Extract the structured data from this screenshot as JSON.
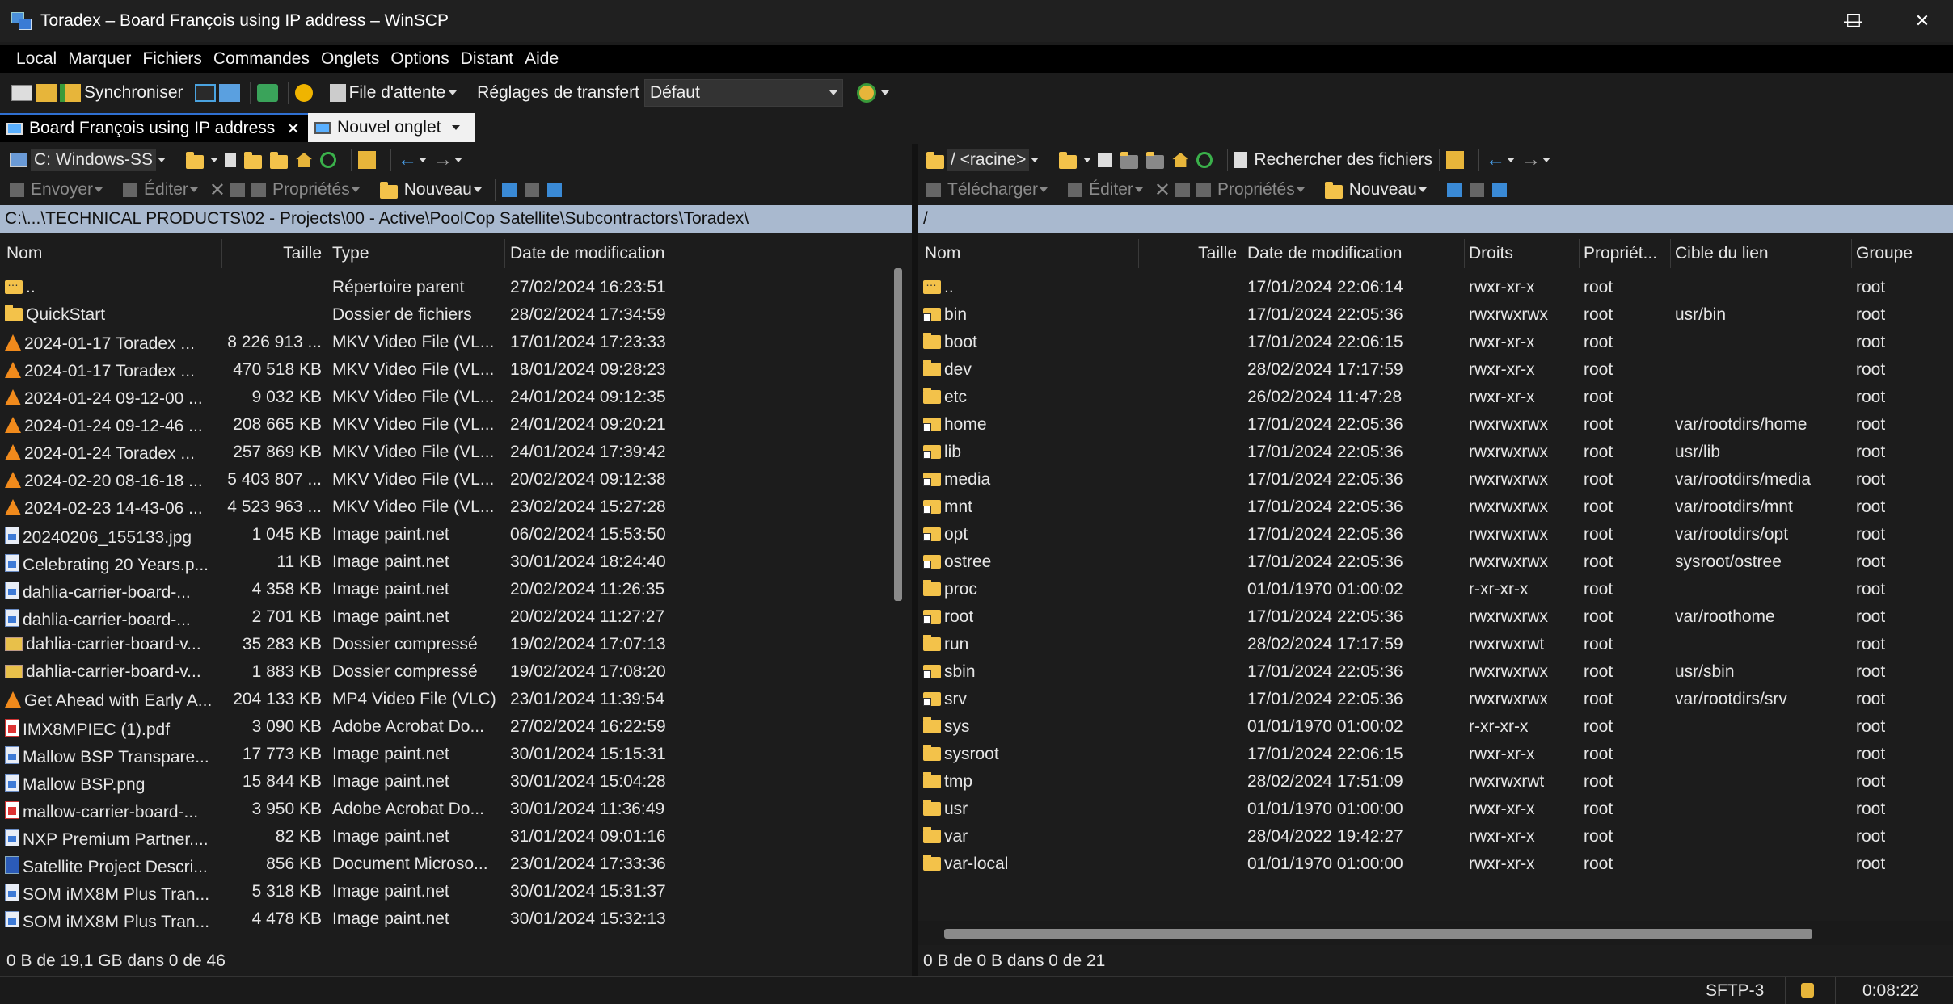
{
  "window": {
    "title": "Toradex – Board François using IP address – WinSCP",
    "min_glyph": "—",
    "max_glyph": "☐",
    "close_glyph": "✕"
  },
  "menu": [
    "Local",
    "Marquer",
    "Fichiers",
    "Commandes",
    "Onglets",
    "Options",
    "Distant",
    "Aide"
  ],
  "toolbar": {
    "sync_label": "Synchroniser",
    "queue_label": "File d'attente",
    "transfer_settings_label": "Réglages de transfert",
    "transfer_preset": "Défaut"
  },
  "tabs": [
    {
      "label": "Board François using IP address",
      "close": "✕"
    },
    {
      "label": "Nouvel onglet"
    }
  ],
  "left": {
    "drive": "C: Windows-SS",
    "actions": {
      "send": "Envoyer",
      "edit": "Éditer",
      "props": "Propriétés",
      "new": "Nouveau"
    },
    "path": "C:\\...\\TECHNICAL PRODUCTS\\02 - Projects\\00 - Active\\PoolCop Satellite\\Subcontractors\\Toradex\\",
    "columns": {
      "name": "Nom",
      "size": "Taille",
      "type": "Type",
      "date": "Date de modification"
    },
    "rows": [
      {
        "icon": "up",
        "name": "..",
        "size": "",
        "type": "Répertoire parent",
        "date": "27/02/2024 16:23:51"
      },
      {
        "icon": "folder",
        "name": "QuickStart",
        "size": "",
        "type": "Dossier de fichiers",
        "date": "28/02/2024 17:34:59"
      },
      {
        "icon": "vlc",
        "name": "2024-01-17 Toradex ...",
        "size": "8 226 913 ...",
        "type": "MKV Video File (VL...",
        "date": "17/01/2024 17:23:33"
      },
      {
        "icon": "vlc",
        "name": "2024-01-17 Toradex ...",
        "size": "470 518 KB",
        "type": "MKV Video File (VL...",
        "date": "18/01/2024 09:28:23"
      },
      {
        "icon": "vlc",
        "name": "2024-01-24 09-12-00 ...",
        "size": "9 032 KB",
        "type": "MKV Video File (VL...",
        "date": "24/01/2024 09:12:35"
      },
      {
        "icon": "vlc",
        "name": "2024-01-24 09-12-46 ...",
        "size": "208 665 KB",
        "type": "MKV Video File (VL...",
        "date": "24/01/2024 09:20:21"
      },
      {
        "icon": "vlc",
        "name": "2024-01-24 Toradex ...",
        "size": "257 869 KB",
        "type": "MKV Video File (VL...",
        "date": "24/01/2024 17:39:42"
      },
      {
        "icon": "vlc",
        "name": "2024-02-20 08-16-18 ...",
        "size": "5 403 807 ...",
        "type": "MKV Video File (VL...",
        "date": "20/02/2024 09:12:38"
      },
      {
        "icon": "vlc",
        "name": "2024-02-23 14-43-06 ...",
        "size": "4 523 963 ...",
        "type": "MKV Video File (VL...",
        "date": "23/02/2024 15:27:28"
      },
      {
        "icon": "img",
        "name": "20240206_155133.jpg",
        "size": "1 045 KB",
        "type": "Image paint.net",
        "date": "06/02/2024 15:53:50"
      },
      {
        "icon": "img",
        "name": "Celebrating 20 Years.p...",
        "size": "11 KB",
        "type": "Image paint.net",
        "date": "30/01/2024 18:24:40"
      },
      {
        "icon": "img",
        "name": "dahlia-carrier-board-...",
        "size": "4 358 KB",
        "type": "Image paint.net",
        "date": "20/02/2024 11:26:35"
      },
      {
        "icon": "img",
        "name": "dahlia-carrier-board-...",
        "size": "2 701 KB",
        "type": "Image paint.net",
        "date": "20/02/2024 11:27:27"
      },
      {
        "icon": "zip",
        "name": "dahlia-carrier-board-v...",
        "size": "35 283 KB",
        "type": "Dossier compressé",
        "date": "19/02/2024 17:07:13"
      },
      {
        "icon": "zip",
        "name": "dahlia-carrier-board-v...",
        "size": "1 883 KB",
        "type": "Dossier compressé",
        "date": "19/02/2024 17:08:20"
      },
      {
        "icon": "vlc",
        "name": "Get Ahead with Early A...",
        "size": "204 133 KB",
        "type": "MP4 Video File (VLC)",
        "date": "23/01/2024 11:39:54"
      },
      {
        "icon": "pdf",
        "name": "IMX8MPIEC (1).pdf",
        "size": "3 090 KB",
        "type": "Adobe Acrobat Do...",
        "date": "27/02/2024 16:22:59"
      },
      {
        "icon": "img",
        "name": "Mallow BSP Transpare...",
        "size": "17 773 KB",
        "type": "Image paint.net",
        "date": "30/01/2024 15:15:31"
      },
      {
        "icon": "img",
        "name": "Mallow BSP.png",
        "size": "15 844 KB",
        "type": "Image paint.net",
        "date": "30/01/2024 15:04:28"
      },
      {
        "icon": "pdf",
        "name": "mallow-carrier-board-...",
        "size": "3 950 KB",
        "type": "Adobe Acrobat Do...",
        "date": "30/01/2024 11:36:49"
      },
      {
        "icon": "img",
        "name": "NXP Premium Partner....",
        "size": "82 KB",
        "type": "Image paint.net",
        "date": "31/01/2024 09:01:16"
      },
      {
        "icon": "doc",
        "name": "Satellite Project Descri...",
        "size": "856 KB",
        "type": "Document Microso...",
        "date": "23/01/2024 17:33:36"
      },
      {
        "icon": "img",
        "name": "SOM iMX8M Plus Tran...",
        "size": "5 318 KB",
        "type": "Image paint.net",
        "date": "30/01/2024 15:31:37"
      },
      {
        "icon": "img",
        "name": "SOM iMX8M Plus Tran...",
        "size": "4 478 KB",
        "type": "Image paint.net",
        "date": "30/01/2024 15:32:13"
      }
    ],
    "status": "0 B de 19,1 GB dans 0 de 46"
  },
  "right": {
    "drive": "/ <racine>",
    "search_label": "Rechercher des fichiers",
    "actions": {
      "download": "Télécharger",
      "edit": "Éditer",
      "props": "Propriétés",
      "new": "Nouveau"
    },
    "path": "/",
    "columns": {
      "name": "Nom",
      "size": "Taille",
      "date": "Date de modification",
      "rights": "Droits",
      "owner": "Propriét...",
      "target": "Cible du lien",
      "group": "Groupe"
    },
    "rows": [
      {
        "icon": "up",
        "name": "..",
        "date": "17/01/2024 22:06:14",
        "rights": "rwxr-xr-x",
        "owner": "root",
        "target": "",
        "group": "root"
      },
      {
        "icon": "link",
        "name": "bin",
        "date": "17/01/2024 22:05:36",
        "rights": "rwxrwxrwx",
        "owner": "root",
        "target": "usr/bin",
        "group": "root"
      },
      {
        "icon": "folder",
        "name": "boot",
        "date": "17/01/2024 22:06:15",
        "rights": "rwxr-xr-x",
        "owner": "root",
        "target": "",
        "group": "root"
      },
      {
        "icon": "folder",
        "name": "dev",
        "date": "28/02/2024 17:17:59",
        "rights": "rwxr-xr-x",
        "owner": "root",
        "target": "",
        "group": "root"
      },
      {
        "icon": "folder",
        "name": "etc",
        "date": "26/02/2024 11:47:28",
        "rights": "rwxr-xr-x",
        "owner": "root",
        "target": "",
        "group": "root"
      },
      {
        "icon": "link",
        "name": "home",
        "date": "17/01/2024 22:05:36",
        "rights": "rwxrwxrwx",
        "owner": "root",
        "target": "var/rootdirs/home",
        "group": "root"
      },
      {
        "icon": "link",
        "name": "lib",
        "date": "17/01/2024 22:05:36",
        "rights": "rwxrwxrwx",
        "owner": "root",
        "target": "usr/lib",
        "group": "root"
      },
      {
        "icon": "link",
        "name": "media",
        "date": "17/01/2024 22:05:36",
        "rights": "rwxrwxrwx",
        "owner": "root",
        "target": "var/rootdirs/media",
        "group": "root"
      },
      {
        "icon": "link",
        "name": "mnt",
        "date": "17/01/2024 22:05:36",
        "rights": "rwxrwxrwx",
        "owner": "root",
        "target": "var/rootdirs/mnt",
        "group": "root"
      },
      {
        "icon": "link",
        "name": "opt",
        "date": "17/01/2024 22:05:36",
        "rights": "rwxrwxrwx",
        "owner": "root",
        "target": "var/rootdirs/opt",
        "group": "root"
      },
      {
        "icon": "link",
        "name": "ostree",
        "date": "17/01/2024 22:05:36",
        "rights": "rwxrwxrwx",
        "owner": "root",
        "target": "sysroot/ostree",
        "group": "root"
      },
      {
        "icon": "folder",
        "name": "proc",
        "date": "01/01/1970 01:00:02",
        "rights": "r-xr-xr-x",
        "owner": "root",
        "target": "",
        "group": "root"
      },
      {
        "icon": "link",
        "name": "root",
        "date": "17/01/2024 22:05:36",
        "rights": "rwxrwxrwx",
        "owner": "root",
        "target": "var/roothome",
        "group": "root"
      },
      {
        "icon": "folder",
        "name": "run",
        "date": "28/02/2024 17:17:59",
        "rights": "rwxrwxrwt",
        "owner": "root",
        "target": "",
        "group": "root"
      },
      {
        "icon": "link",
        "name": "sbin",
        "date": "17/01/2024 22:05:36",
        "rights": "rwxrwxrwx",
        "owner": "root",
        "target": "usr/sbin",
        "group": "root"
      },
      {
        "icon": "link",
        "name": "srv",
        "date": "17/01/2024 22:05:36",
        "rights": "rwxrwxrwx",
        "owner": "root",
        "target": "var/rootdirs/srv",
        "group": "root"
      },
      {
        "icon": "folder",
        "name": "sys",
        "date": "01/01/1970 01:00:02",
        "rights": "r-xr-xr-x",
        "owner": "root",
        "target": "",
        "group": "root"
      },
      {
        "icon": "folder",
        "name": "sysroot",
        "date": "17/01/2024 22:06:15",
        "rights": "rwxr-xr-x",
        "owner": "root",
        "target": "",
        "group": "root"
      },
      {
        "icon": "folder",
        "name": "tmp",
        "date": "28/02/2024 17:51:09",
        "rights": "rwxrwxrwt",
        "owner": "root",
        "target": "",
        "group": "root"
      },
      {
        "icon": "folder",
        "name": "usr",
        "date": "01/01/1970 01:00:00",
        "rights": "rwxr-xr-x",
        "owner": "root",
        "target": "",
        "group": "root"
      },
      {
        "icon": "folder",
        "name": "var",
        "date": "28/04/2022 19:42:27",
        "rights": "rwxr-xr-x",
        "owner": "root",
        "target": "",
        "group": "root"
      },
      {
        "icon": "folder",
        "name": "var-local",
        "date": "01/01/1970 01:00:00",
        "rights": "rwxr-xr-x",
        "owner": "root",
        "target": "",
        "group": "root"
      }
    ],
    "status": "0 B de 0 B dans 0 de 21"
  },
  "statusbar": {
    "protocol": "SFTP-3",
    "elapsed": "0:08:22"
  },
  "colors": {
    "path_bar": "#a9b9cf",
    "folder": "#f3c24a",
    "vlc": "#f08a1c",
    "tab_accent": "#2f6fd1"
  }
}
